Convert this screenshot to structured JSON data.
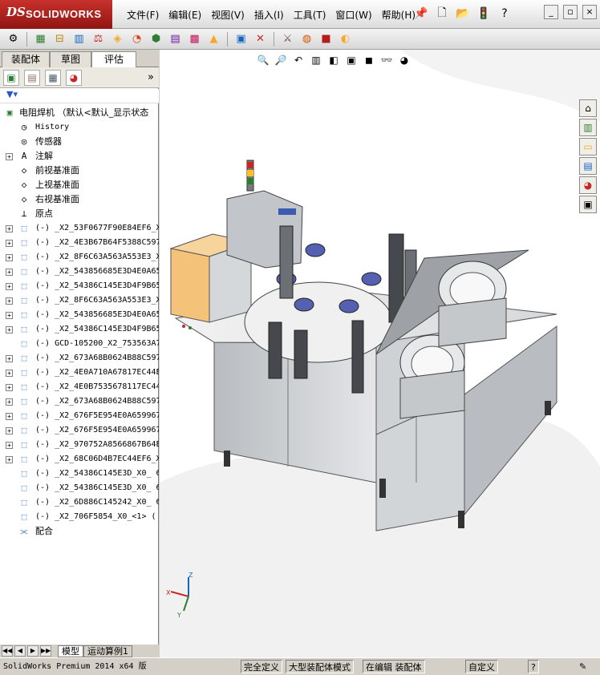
{
  "app": {
    "logo_mark": "DS",
    "logo_text": "SOLIDWORKS"
  },
  "menu": [
    "文件(F)",
    "编辑(E)",
    "视图(V)",
    "插入(I)",
    "工具(T)",
    "窗口(W)",
    "帮助(H)"
  ],
  "title_tools": {
    "help_glyph": "?"
  },
  "tabs": [
    "装配体",
    "草图",
    "评估"
  ],
  "active_tab": 2,
  "tree": {
    "root_label": "电阻焊机 （默认<默认_显示状态",
    "fixed": [
      {
        "label": "History",
        "icon": "history-icon",
        "mono": true
      },
      {
        "label": "传感器",
        "icon": "sensor-icon",
        "mono": false
      },
      {
        "label": "注解",
        "icon": "annotation-icon",
        "mono": false,
        "expand": true
      },
      {
        "label": "前视基准面",
        "icon": "plane-icon",
        "mono": false
      },
      {
        "label": "上视基准面",
        "icon": "plane-icon",
        "mono": false
      },
      {
        "label": "右视基准面",
        "icon": "plane-icon",
        "mono": false
      },
      {
        "label": "原点",
        "icon": "origin-icon",
        "mono": false
      }
    ],
    "components": [
      "(-) _X2_53F0677F90E84EF6_X",
      "(-) _X2_4E3B67B64F5388C597",
      "(-) _X2_8F6C63A563A553E3_X",
      "(-) _X2_543856685E3D4E0A65",
      "(-) _X2_54386C145E3D4F9B65",
      "(-) _X2_8F6C63A563A553E3_X",
      "(-) _X2_543856685E3D4E0A65",
      "(-) _X2_54386C145E3D4F9B65",
      "(-) GCD-105200_X2_753563A7",
      "(-) _X2_673A68B0624B88C597",
      "(-) _X2_4E0A710A67817EC44E",
      "(-) _X2_4E0B7535678117EC44E",
      "(-) _X2_673A68B0624B88C597",
      "(-) _X2_676F5E954E0A659967",
      "(-) _X2_676F5E954E0A659967",
      "(-) _X2_970752A8566867B64E",
      "(-) _X2_68C06D4B7EC44EF6_X",
      "(-) _X2_54386C145E3D_X0_ 6",
      "(-) _X2_54386C145E3D_X0_ 6",
      "(-) _X2_6D886C145242_X0_ 6",
      "(-) _X2_706F5854_X0_<1> (",
      "配合"
    ]
  },
  "bottom_tabs": [
    "模型",
    "运动算例1"
  ],
  "status": {
    "product": "SolidWorks Premium 2014 x64 版",
    "fully_defined": "完全定义",
    "large_asm": "大型装配体模式",
    "editing": "在编辑 装配体",
    "custom": "自定义",
    "help": "?"
  },
  "colors": {
    "accent_red": "#b3221e",
    "tree_part_blue": "#1d5fb3",
    "machine_gray": "#c8ccd0",
    "control_box_orange": "#f5c27a"
  }
}
